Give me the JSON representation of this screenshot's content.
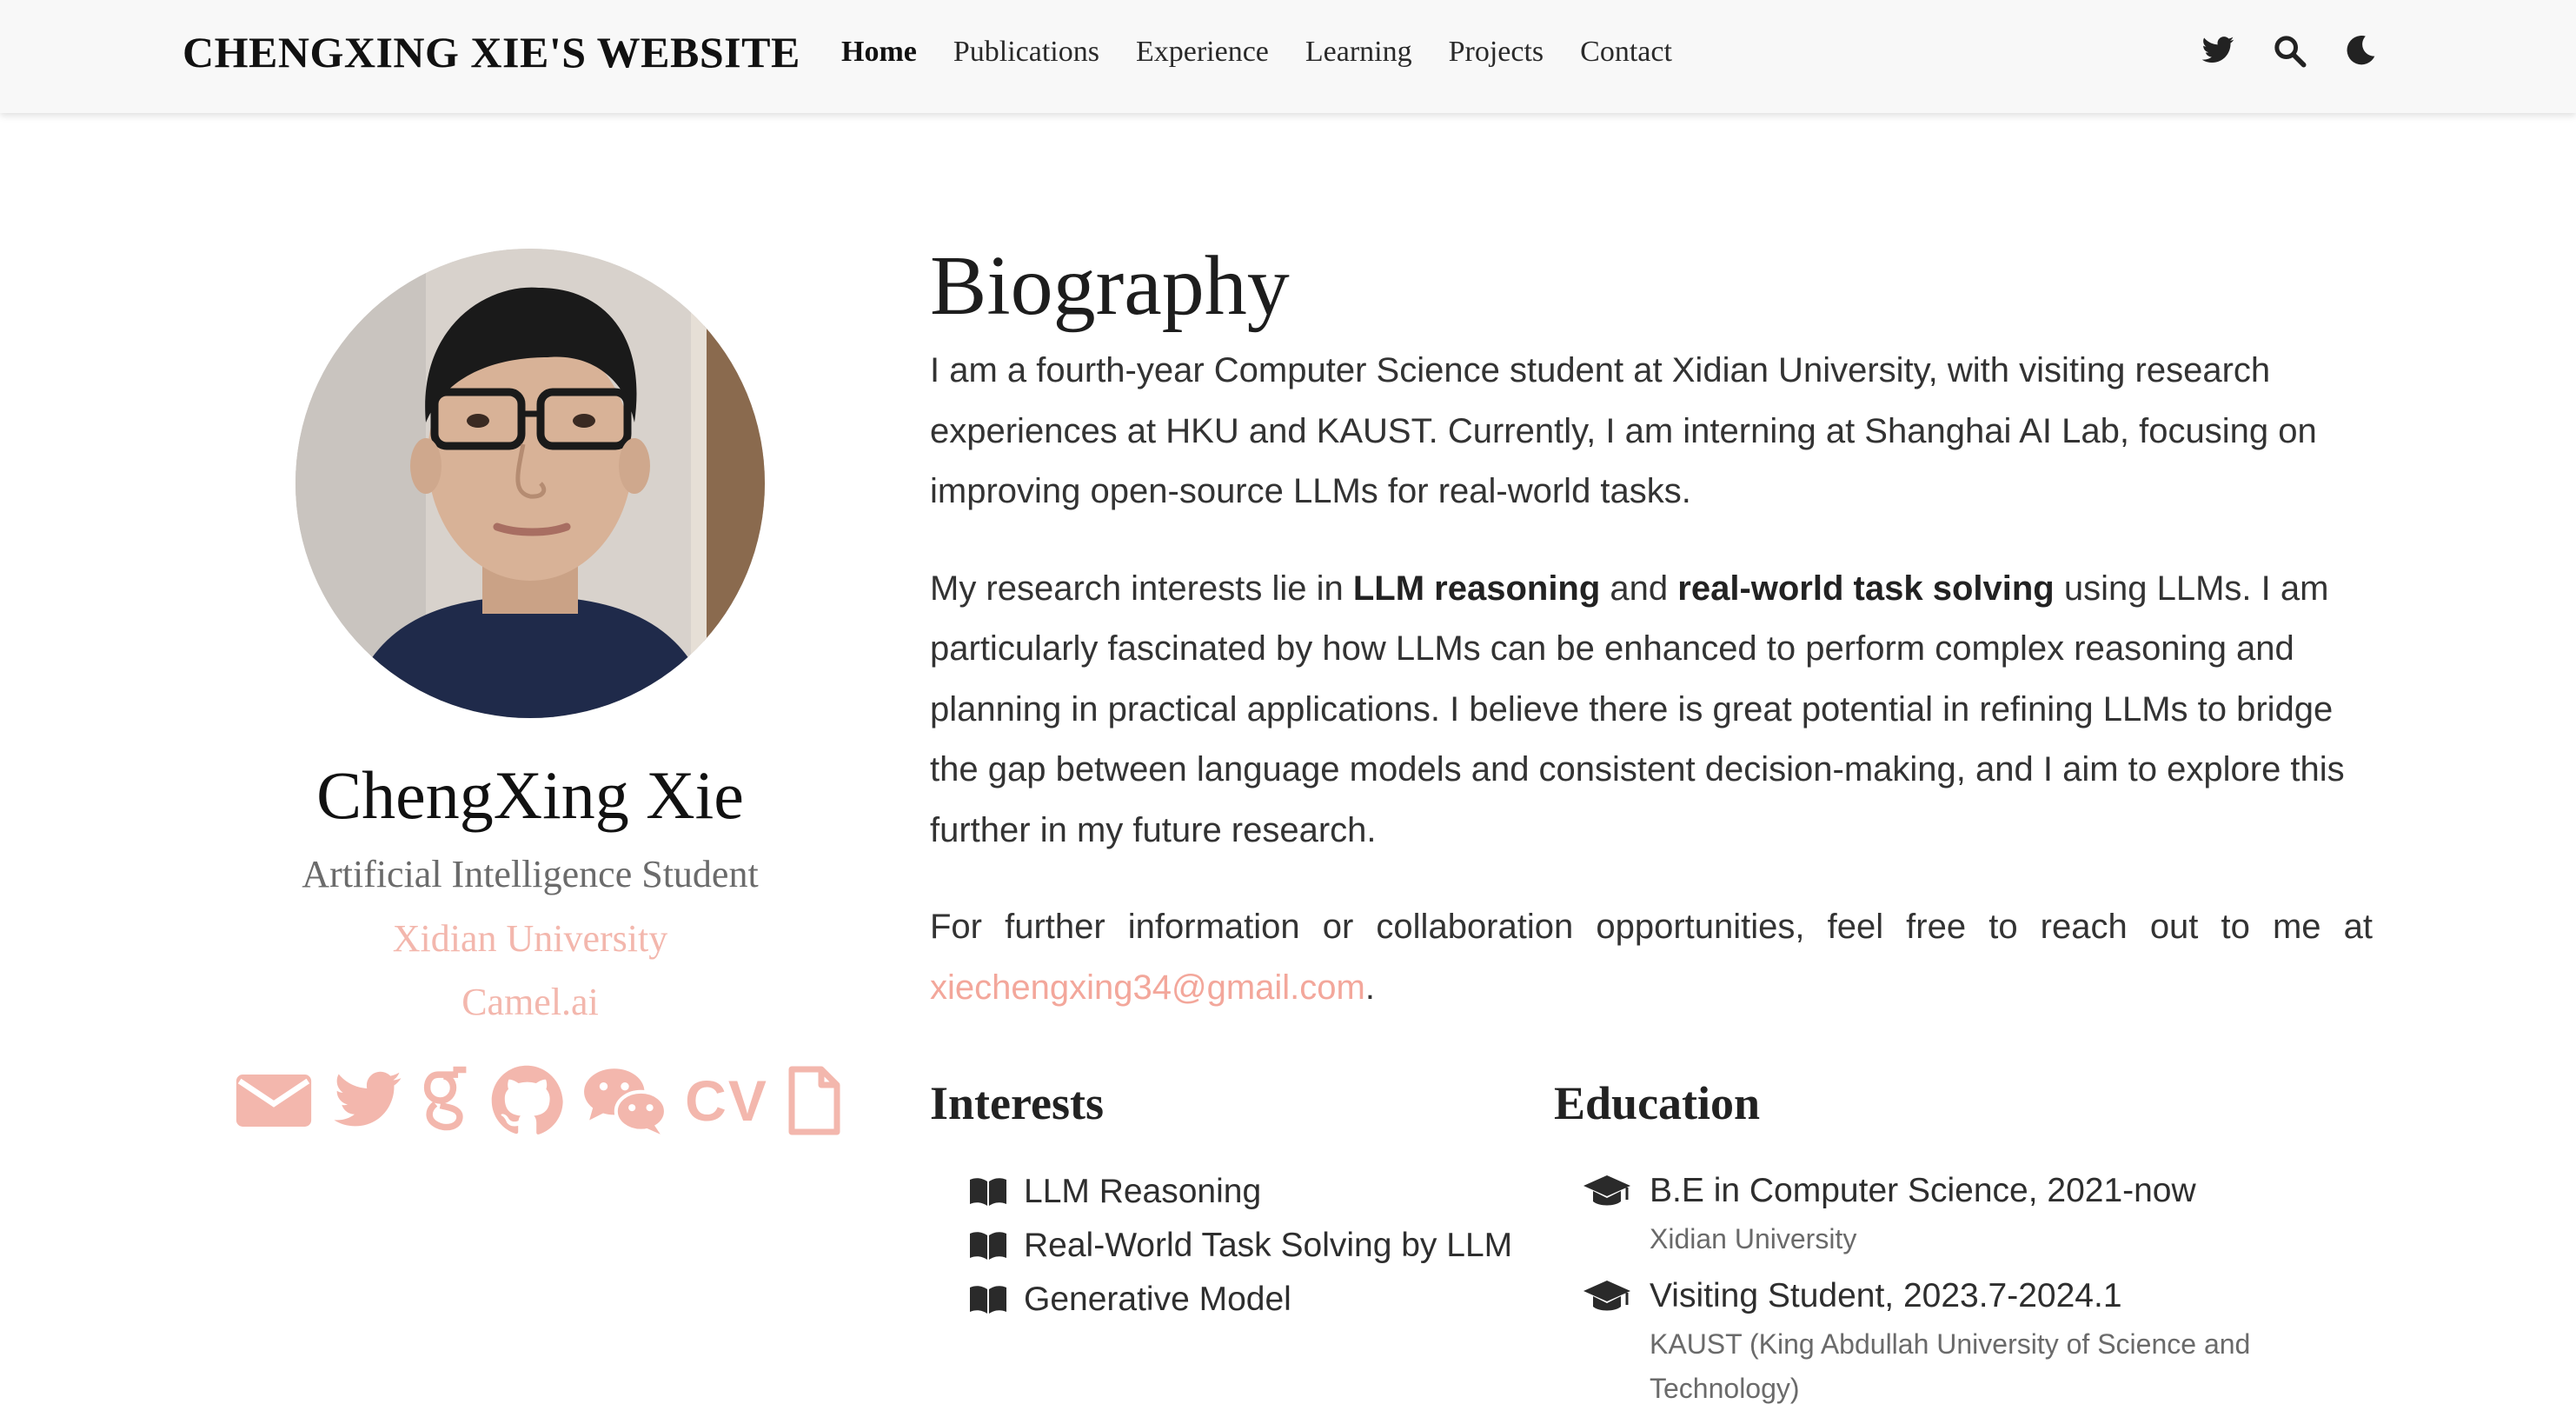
{
  "navbar": {
    "brand": "CHENGXING XIE'S WEBSITE",
    "links": [
      {
        "label": "Home",
        "active": true
      },
      {
        "label": "Publications",
        "active": false
      },
      {
        "label": "Experience",
        "active": false
      },
      {
        "label": "Learning",
        "active": false
      },
      {
        "label": "Projects",
        "active": false
      },
      {
        "label": "Contact",
        "active": false
      }
    ],
    "icons": [
      "twitter-icon",
      "search-icon",
      "moon-icon"
    ]
  },
  "profile": {
    "name": "ChengXing Xie",
    "role": "Artificial Intelligence Student",
    "organizations": [
      "Xidian University",
      "Camel.ai"
    ],
    "socials": [
      "email-icon",
      "twitter-icon",
      "google-scholar-icon",
      "github-icon",
      "wechat-icon",
      "cv-icon",
      "document-icon"
    ],
    "cv_label": "CV",
    "accent_color": "#f3b7ad"
  },
  "biography": {
    "heading": "Biography",
    "p1": "I am a fourth-year Computer Science student at Xidian University, with visiting research experiences at HKU and KAUST. Currently, I am interning at Shanghai AI Lab, focusing on improving open-source LLMs for real-world tasks.",
    "p2_before": "My research interests lie in ",
    "p2_bold1": "LLM reasoning",
    "p2_mid": " and ",
    "p2_bold2": "real-world task solving",
    "p2_after": " using LLMs. I am particularly fascinated by how LLMs can be enhanced to perform complex reasoning and planning in practical applications. I believe there is great potential in refining LLMs to bridge the gap between language models and consistent decision-making, and I aim to explore this further in my future research.",
    "p3_before": "For further information or collaboration opportunities, feel free to reach out to me at ",
    "email": "xiechengxing34@gmail.com",
    "p3_after": "."
  },
  "interests": {
    "heading": "Interests",
    "items": [
      "LLM Reasoning",
      "Real-World Task Solving by LLM",
      "Generative Model"
    ]
  },
  "education": {
    "heading": "Education",
    "items": [
      {
        "title": "B.E in Computer Science, 2021-now",
        "institution": "Xidian University"
      },
      {
        "title": "Visiting Student, 2023.7-2024.1",
        "institution": "KAUST (King Abdullah University of Science and Technology)"
      }
    ]
  }
}
